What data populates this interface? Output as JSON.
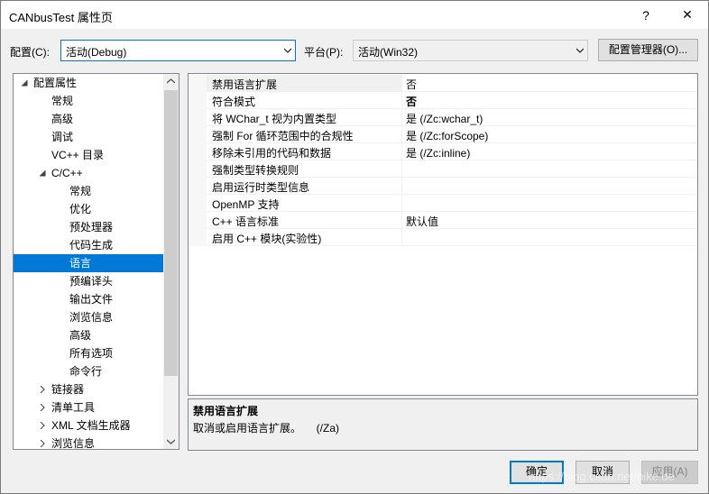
{
  "window": {
    "title": "CANbusTest 属性页",
    "help_glyph": "?",
    "close_glyph": "✕"
  },
  "config": {
    "config_label": "配置(C):",
    "config_value": "活动(Debug)",
    "platform_label": "平台(P):",
    "platform_value": "活动(Win32)",
    "manager_button": "配置管理器(O)..."
  },
  "tree": {
    "items": [
      {
        "label": "配置属性",
        "level": 0,
        "expanded": true
      },
      {
        "label": "常规",
        "level": 1
      },
      {
        "label": "高级",
        "level": 1
      },
      {
        "label": "调试",
        "level": 1
      },
      {
        "label": "VC++ 目录",
        "level": 1
      },
      {
        "label": "C/C++",
        "level": 1,
        "expanded": true
      },
      {
        "label": "常规",
        "level": 2
      },
      {
        "label": "优化",
        "level": 2
      },
      {
        "label": "预处理器",
        "level": 2
      },
      {
        "label": "代码生成",
        "level": 2
      },
      {
        "label": "语言",
        "level": 2,
        "selected": true
      },
      {
        "label": "预编译头",
        "level": 2
      },
      {
        "label": "输出文件",
        "level": 2
      },
      {
        "label": "浏览信息",
        "level": 2
      },
      {
        "label": "高级",
        "level": 2
      },
      {
        "label": "所有选项",
        "level": 2
      },
      {
        "label": "命令行",
        "level": 2
      },
      {
        "label": "链接器",
        "level": 1,
        "expanded": false
      },
      {
        "label": "清单工具",
        "level": 1,
        "expanded": false
      },
      {
        "label": "XML 文档生成器",
        "level": 1,
        "expanded": false
      },
      {
        "label": "浏览信息",
        "level": 1,
        "expanded": false
      }
    ]
  },
  "properties": [
    {
      "name": "禁用语言扩展",
      "value": "否",
      "selected": true,
      "bold": false
    },
    {
      "name": "符合模式",
      "value": "否",
      "bold": true
    },
    {
      "name": "将 WChar_t 视为内置类型",
      "value": "是 (/Zc:wchar_t)",
      "bold": false
    },
    {
      "name": "强制 For 循环范围中的合规性",
      "value": "是 (/Zc:forScope)",
      "bold": false
    },
    {
      "name": "移除未引用的代码和数据",
      "value": "是 (/Zc:inline)",
      "bold": false
    },
    {
      "name": "强制类型转换规则",
      "value": "",
      "bold": false
    },
    {
      "name": "启用运行时类型信息",
      "value": "",
      "bold": false
    },
    {
      "name": "OpenMP 支持",
      "value": "",
      "bold": false
    },
    {
      "name": "C++ 语言标准",
      "value": "默认值",
      "bold": false
    },
    {
      "name": "启用 C++ 模块(实验性)",
      "value": "",
      "bold": false
    }
  ],
  "description": {
    "title": "禁用语言扩展",
    "text": "取消或启用语言扩展。     (/Za)"
  },
  "buttons": {
    "ok": "确定",
    "cancel": "取消",
    "apply": "应用(A)"
  },
  "watermark": "https://blog.csdn.net/bike.de",
  "colors": {
    "selection": "#0078d7",
    "window_bg": "#f0f0f0"
  }
}
